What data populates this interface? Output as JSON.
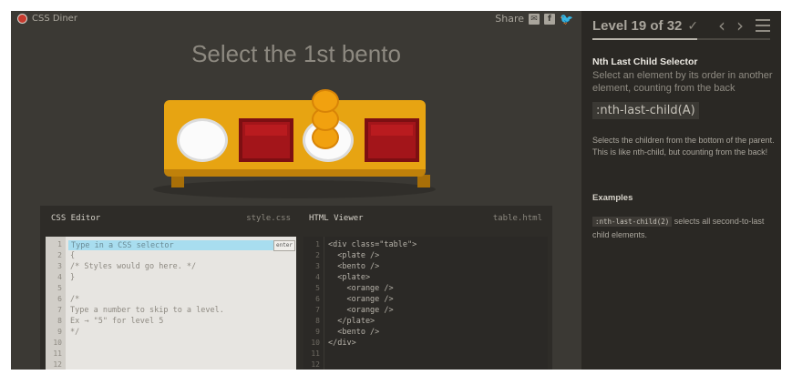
{
  "header": {
    "app_name": "CSS Diner",
    "share_label": "Share",
    "share_icons": [
      "email-icon",
      "facebook-icon",
      "twitter-icon"
    ]
  },
  "instruction": "Select the 1st bento",
  "table_items": [
    "plate",
    "bento",
    "plate (with 3 oranges)",
    "bento"
  ],
  "css_editor": {
    "title": "CSS Editor",
    "file": "style.css",
    "placeholder": "Type in a CSS selector",
    "enter_label": "enter",
    "line_numbers": [
      "1",
      "2",
      "3",
      "4",
      "5",
      "6",
      "7",
      "8",
      "9",
      "10",
      "11",
      "12"
    ],
    "lines": [
      "",
      "{",
      "/* Styles would go here. */",
      "}",
      "",
      "/*",
      "Type a number to skip to a level.",
      "Ex → \"5\" for level 5",
      "*/",
      "",
      "",
      ""
    ]
  },
  "html_viewer": {
    "title": "HTML Viewer",
    "file": "table.html",
    "line_numbers": [
      "1",
      "2",
      "3",
      "4",
      "5",
      "6",
      "7",
      "8",
      "9",
      "10",
      "11",
      "12"
    ],
    "lines": [
      "<div class=\"table\">",
      "  <plate />",
      "  <bento />",
      "  <plate>",
      "    <orange />",
      "    <orange />",
      "    <orange />",
      "  </plate>",
      "  <bento />",
      "</div>",
      "",
      ""
    ]
  },
  "sidebar": {
    "level_text": "Level 19 of 32",
    "level_current": 19,
    "level_total": 32,
    "progress_fraction": 0.59,
    "selector_name": "Nth Last Child Selector",
    "selector_title": "Select an element by its order in another element, counting from the back",
    "syntax": ":nth-last-child(A)",
    "hint": "Selects the children from the bottom of the parent. This is like nth-child, but counting from the back!",
    "examples_heading": "Examples",
    "example_code": ":nth-last-child(2)",
    "example_text": " selects all second-to-last child elements."
  },
  "colors": {
    "background": "#3b3934",
    "sidebar": "#2a2824",
    "table": "#e7a412",
    "bento": "#a3151a",
    "orange": "#f1a10f",
    "input_highlight": "#a8ddef"
  }
}
